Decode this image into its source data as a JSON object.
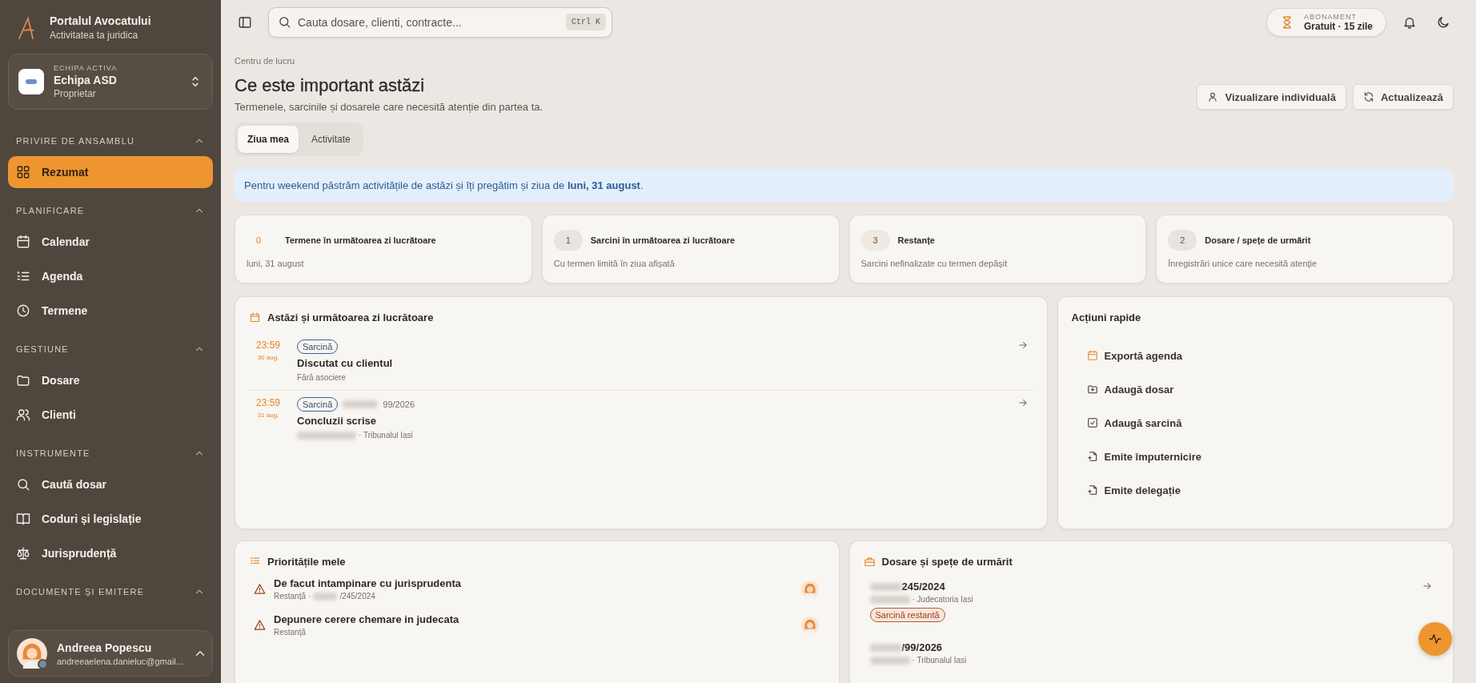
{
  "app": {
    "name": "Portalul Avocatului",
    "tagline": "Activitatea ta juridica"
  },
  "team": {
    "label": "ECHIPA ACTIVA",
    "name": "Echipa ASD",
    "role": "Proprietar"
  },
  "sidebar": {
    "sections": [
      {
        "title": "PRIVIRE DE ANSAMBLU",
        "expanded": true,
        "items": [
          {
            "label": "Rezumat",
            "kind": "grid",
            "selected": true
          }
        ]
      },
      {
        "title": "PLANIFICARE",
        "expanded": true,
        "items": [
          {
            "label": "Calendar",
            "kind": "calendar",
            "selected": false
          },
          {
            "label": "Agenda",
            "kind": "list",
            "selected": false
          },
          {
            "label": "Termene",
            "kind": "clock",
            "selected": false
          }
        ]
      },
      {
        "title": "GESTIUNE",
        "expanded": true,
        "items": [
          {
            "label": "Dosare",
            "kind": "folder",
            "selected": false
          },
          {
            "label": "Clienti",
            "kind": "users",
            "selected": false
          }
        ]
      },
      {
        "title": "INSTRUMENTE",
        "expanded": true,
        "items": [
          {
            "label": "Caută dosar",
            "kind": "search",
            "selected": false
          },
          {
            "label": "Coduri și legislație",
            "kind": "book",
            "selected": false
          },
          {
            "label": "Jurisprudență",
            "kind": "scale",
            "selected": false
          }
        ]
      },
      {
        "title": "DOCUMENTE ȘI EMITERE",
        "expanded": true
      }
    ]
  },
  "user": {
    "name": "Andreea Popescu",
    "email": "andreeaelena.danieluc@gmail..."
  },
  "topbar": {
    "search": {
      "placeholder": "Cauta dosare, clienti, contracte...",
      "shortcut": "Ctrl K"
    },
    "subscription": {
      "label": "ABONAMENT",
      "value": "Gratuit · 15 zile"
    }
  },
  "header": {
    "breadcrumb": "Centru de lucru",
    "title": "Ce este important astăzi",
    "subtitle": "Termenele, sarcinile și dosarele care necesită atenție din partea ta.",
    "buttons": [
      {
        "label": "Vizualizare individuală",
        "kind": "user"
      },
      {
        "label": "Actualizează",
        "kind": "refresh"
      }
    ]
  },
  "tabs": [
    {
      "label": "Ziua mea",
      "selected": true
    },
    {
      "label": "Activitate",
      "selected": false
    }
  ],
  "banner": "Pentru weekend păstrăm activitățile de astăzi și îți pregătim și ziua de **luni, 31 august**.",
  "stats": [
    {
      "count": "0",
      "kind": "accent",
      "title": "Termene în următoarea zi lucrătoare",
      "subtitle": "luni, 31 august"
    },
    {
      "count": "1",
      "kind": "neutral",
      "title": "Sarcini în următoarea zi lucrătoare",
      "subtitle": "Cu termen limită în ziua afișată"
    },
    {
      "count": "3",
      "kind": "danger",
      "title": "Restanțe",
      "subtitle": "Sarcini nefinalizate cu termen depășit"
    },
    {
      "count": "2",
      "kind": "neutral",
      "title": "Dosare / spețe de urmărit",
      "subtitle": "Înregistrări unice care necesită atenție"
    }
  ],
  "agenda": {
    "title": "Astăzi și următoarea zi lucrătoare",
    "items": [
      {
        "time": "23:59",
        "date": "30 aug.",
        "tag": "Sarcină",
        "title": "Discutat cu clientul",
        "subtitle": "Fără asociere",
        "redacted": false
      },
      {
        "time": "23:59",
        "date": "31 aug.",
        "tag": "Sarcină",
        "case_ref": "99/2026",
        "title": "Concluzii scrise",
        "subtitle": "· Tribunalul Iasi",
        "redacted": true
      }
    ]
  },
  "quick_actions": {
    "title": "Acțiuni rapide",
    "items": [
      {
        "label": "Exportă agenda",
        "kind": "calendar-export"
      },
      {
        "label": "Adaugă dosar",
        "kind": "folder-plus"
      },
      {
        "label": "Adaugă sarcină",
        "kind": "check-square"
      },
      {
        "label": "Emite împuternicire",
        "kind": "file-plus"
      },
      {
        "label": "Emite delegație",
        "kind": "file-plus"
      }
    ]
  },
  "priorities": {
    "title": "Prioritățile mele",
    "items": [
      {
        "title": "De facut intampinare cu jurisprudenta",
        "status": "Restanță",
        "separator": "·",
        "case_ref": "/245/2024"
      },
      {
        "title": "Depunere cerere chemare in judecata",
        "status": "Restanță"
      }
    ]
  },
  "watch": {
    "title": "Dosare și spețe de urmărit",
    "items": [
      {
        "case_ref": "245/2024",
        "court": "· Judecatoria Iasi",
        "badge": "Sarcină restantă"
      },
      {
        "case_ref": "/99/2026",
        "court": "· Tribunalul Iasi"
      }
    ]
  }
}
